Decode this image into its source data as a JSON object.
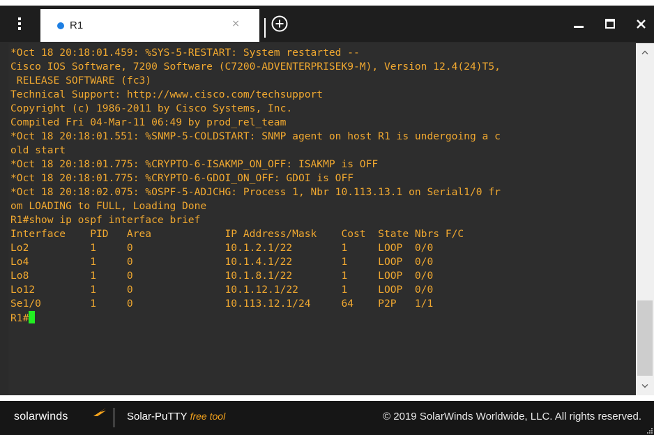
{
  "window": {
    "tab_title": "R1",
    "tab_close_glyph": "×",
    "accent_color": "#1e7fe3",
    "icons": [
      "menu-kebab-icon",
      "tab-status-dot-icon",
      "close-icon",
      "new-tab-icon",
      "minimize-icon",
      "maximize-icon",
      "close-icon"
    ]
  },
  "terminal": {
    "text_color": "#f0a830",
    "cursor_color": "#22ee22",
    "lines": [
      "*Oct 18 20:18:01.459: %SYS-5-RESTART: System restarted --",
      "Cisco IOS Software, 7200 Software (C7200-ADVENTERPRISEK9-M), Version 12.4(24)T5,",
      " RELEASE SOFTWARE (fc3)",
      "Technical Support: http://www.cisco.com/techsupport",
      "Copyright (c) 1986-2011 by Cisco Systems, Inc.",
      "Compiled Fri 04-Mar-11 06:49 by prod_rel_team",
      "*Oct 18 20:18:01.551: %SNMP-5-COLDSTART: SNMP agent on host R1 is undergoing a c",
      "old start",
      "*Oct 18 20:18:01.775: %CRYPTO-6-ISAKMP_ON_OFF: ISAKMP is OFF",
      "*Oct 18 20:18:01.775: %CRYPTO-6-GDOI_ON_OFF: GDOI is OFF",
      "*Oct 18 20:18:02.075: %OSPF-5-ADJCHG: Process 1, Nbr 10.113.13.1 on Serial1/0 fr",
      "om LOADING to FULL, Loading Done",
      "R1#show ip ospf interface brief",
      "Interface    PID   Area            IP Address/Mask    Cost  State Nbrs F/C",
      "Lo2          1     0               10.1.2.1/22        1     LOOP  0/0",
      "Lo4          1     0               10.1.4.1/22        1     LOOP  0/0",
      "Lo8          1     0               10.1.8.1/22        1     LOOP  0/0",
      "Lo12         1     0               10.1.12.1/22       1     LOOP  0/0",
      "Se1/0        1     0               10.113.12.1/24     64    P2P   1/1"
    ],
    "prompt": "R1#"
  },
  "footer": {
    "brand": "solarwinds",
    "product": "Solar-PuTTY",
    "product_tag": "free tool",
    "copyright": "© 2019 SolarWinds Worldwide, LLC. All rights reserved."
  }
}
